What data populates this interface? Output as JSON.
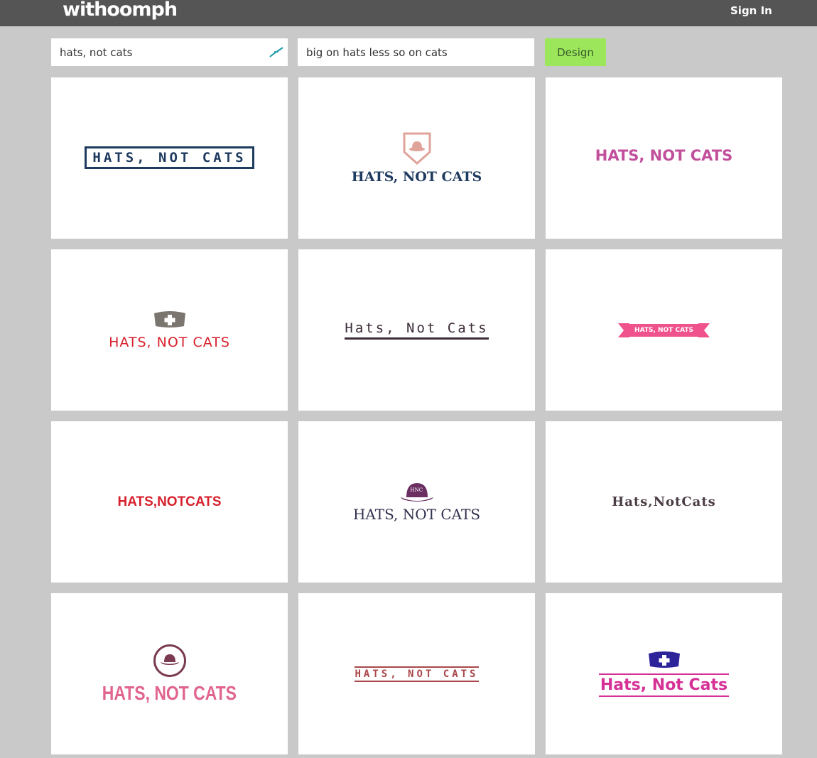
{
  "header": {
    "brand": "withoomph",
    "sign_in_label": "Sign In"
  },
  "search": {
    "name_value": "hats, not cats",
    "description_value": "big on hats less so on cats",
    "design_label": "Design"
  },
  "colors": {
    "topbar": "#555555",
    "background": "#c9c9c9",
    "design_button": "#9be65b"
  },
  "logos": [
    {
      "text": "HATS, NOT CATS",
      "color": "#1e3a5f",
      "icon": "none"
    },
    {
      "text": "HATS, NOT CATS",
      "color": "#1e3a5f",
      "icon": "hat-shield-icon"
    },
    {
      "text": "HATS, NOT CATS",
      "color": "#c14f9c",
      "icon": "none"
    },
    {
      "text": "HATS, NOT CATS",
      "color": "#d7212d",
      "icon": "nurse-cap-icon"
    },
    {
      "text": "Hats, Not Cats",
      "color": "#3a2b38",
      "icon": "none"
    },
    {
      "text": "HATS, NOT CATS",
      "color": "#f0528d",
      "icon": "ribbon-banner"
    },
    {
      "text": "HATS,NOTCATS",
      "color": "#d7212d",
      "icon": "none"
    },
    {
      "text": "HATS, NOT CATS",
      "color": "#30304f",
      "icon": "bowler-hat-icon",
      "badge": "HNC"
    },
    {
      "text": "Hats,NotCats",
      "color": "#4a3b44",
      "icon": "none"
    },
    {
      "text": "HATS, NOT CATS",
      "color": "#e0648d",
      "icon": "hat-circle-icon"
    },
    {
      "text": "HATS, NOT CATS",
      "color": "#a9474a",
      "icon": "none"
    },
    {
      "text": "Hats, Not Cats",
      "color": "#d63096",
      "icon": "nurse-cap-icon"
    }
  ]
}
